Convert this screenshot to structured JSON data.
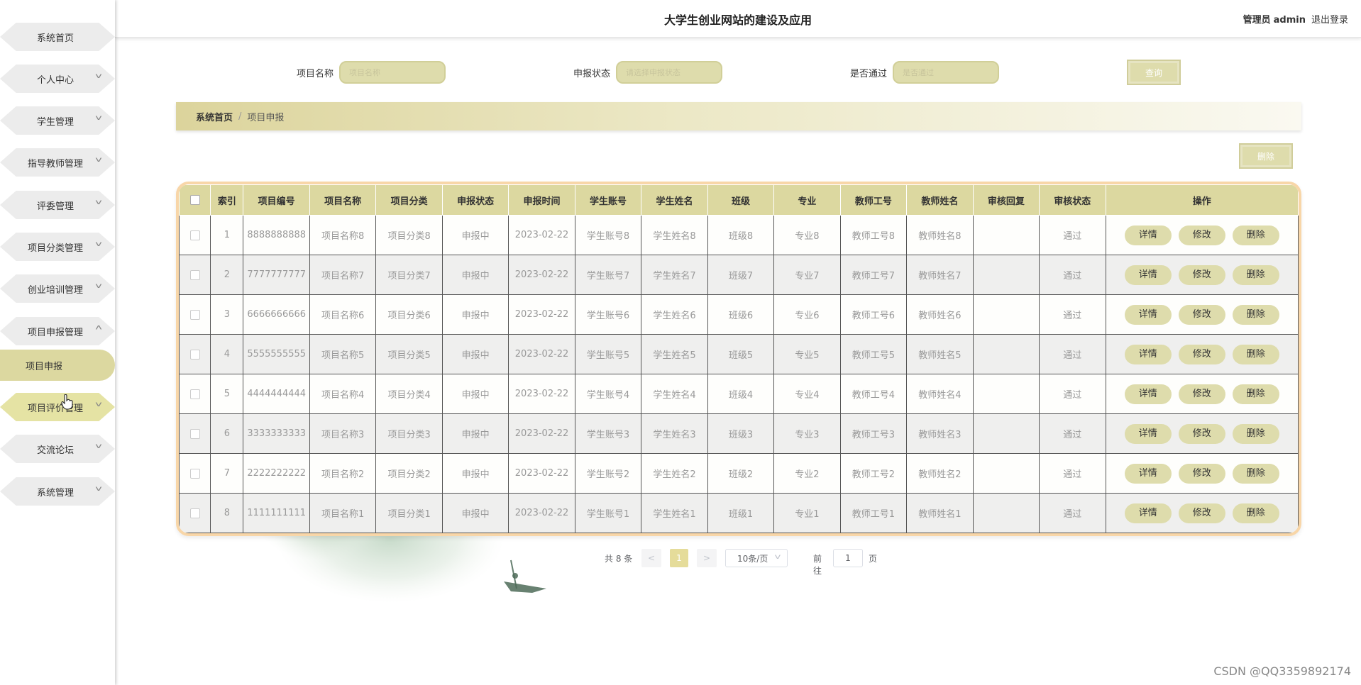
{
  "header": {
    "title": "大学生创业网站的建设及应用",
    "user_role": "管理员",
    "user_name": "admin",
    "logout_label": "退出登录"
  },
  "sidebar": {
    "items": [
      {
        "label": "系统首页",
        "has_chevron": false
      },
      {
        "label": "个人中心",
        "has_chevron": true
      },
      {
        "label": "学生管理",
        "has_chevron": true
      },
      {
        "label": "指导教师管理",
        "has_chevron": true
      },
      {
        "label": "评委管理",
        "has_chevron": true
      },
      {
        "label": "项目分类管理",
        "has_chevron": true
      },
      {
        "label": "创业培训管理",
        "has_chevron": true
      },
      {
        "label": "项目申报管理",
        "has_chevron": true,
        "expanded": true
      },
      {
        "label": "项目评价管理",
        "has_chevron": true
      },
      {
        "label": "交流论坛",
        "has_chevron": true
      },
      {
        "label": "系统管理",
        "has_chevron": true
      }
    ],
    "active_subitem": "项目申报"
  },
  "search": {
    "fields": [
      {
        "label": "项目名称",
        "placeholder": "项目名称"
      },
      {
        "label": "申报状态",
        "placeholder": "请选择申报状态"
      },
      {
        "label": "是否通过",
        "placeholder": "是否通过"
      }
    ],
    "query_button": "查询"
  },
  "breadcrumb": {
    "home": "系统首页",
    "separator": "/",
    "current": "项目申报"
  },
  "toolbar": {
    "delete_button": "删除"
  },
  "table": {
    "columns": [
      "索引",
      "项目编号",
      "项目名称",
      "项目分类",
      "申报状态",
      "申报时间",
      "学生账号",
      "学生姓名",
      "班级",
      "专业",
      "教师工号",
      "教师姓名",
      "审核回复",
      "审核状态",
      "操作"
    ],
    "rows": [
      [
        "1",
        "8888888888",
        "项目名称8",
        "项目分类8",
        "申报中",
        "2023-02-22",
        "学生账号8",
        "学生姓名8",
        "班级8",
        "专业8",
        "教师工号8",
        "教师姓名8",
        "",
        "通过"
      ],
      [
        "2",
        "7777777777",
        "项目名称7",
        "项目分类7",
        "申报中",
        "2023-02-22",
        "学生账号7",
        "学生姓名7",
        "班级7",
        "专业7",
        "教师工号7",
        "教师姓名7",
        "",
        "通过"
      ],
      [
        "3",
        "6666666666",
        "项目名称6",
        "项目分类6",
        "申报中",
        "2023-02-22",
        "学生账号6",
        "学生姓名6",
        "班级6",
        "专业6",
        "教师工号6",
        "教师姓名6",
        "",
        "通过"
      ],
      [
        "4",
        "5555555555",
        "项目名称5",
        "项目分类5",
        "申报中",
        "2023-02-22",
        "学生账号5",
        "学生姓名5",
        "班级5",
        "专业5",
        "教师工号5",
        "教师姓名5",
        "",
        "通过"
      ],
      [
        "5",
        "4444444444",
        "项目名称4",
        "项目分类4",
        "申报中",
        "2023-02-22",
        "学生账号4",
        "学生姓名4",
        "班级4",
        "专业4",
        "教师工号4",
        "教师姓名4",
        "",
        "通过"
      ],
      [
        "6",
        "3333333333",
        "项目名称3",
        "项目分类3",
        "申报中",
        "2023-02-22",
        "学生账号3",
        "学生姓名3",
        "班级3",
        "专业3",
        "教师工号3",
        "教师姓名3",
        "",
        "通过"
      ],
      [
        "7",
        "2222222222",
        "项目名称2",
        "项目分类2",
        "申报中",
        "2023-02-22",
        "学生账号2",
        "学生姓名2",
        "班级2",
        "专业2",
        "教师工号2",
        "教师姓名2",
        "",
        "通过"
      ],
      [
        "8",
        "1111111111",
        "项目名称1",
        "项目分类1",
        "申报中",
        "2023-02-22",
        "学生账号1",
        "学生姓名1",
        "班级1",
        "专业1",
        "教师工号1",
        "教师姓名1",
        "",
        "通过"
      ]
    ],
    "actions": [
      "详情",
      "修改",
      "删除"
    ]
  },
  "pagination": {
    "total_text": "共 8 条",
    "prev": "<",
    "current_page": "1",
    "next": ">",
    "page_size": "10条/页",
    "goto_label": "前往",
    "goto_value": "1",
    "page_suffix": "页"
  },
  "watermark": "CSDN @QQ3359892174",
  "colors": {
    "accent": "#dcd8a0",
    "accent_button": "#dedcac",
    "table_border": "#f8d6a8",
    "sidebar_hex": "#ececec",
    "sidebar_hex_hover": "#e5e3a4"
  },
  "icons": {
    "chevron_down": "chevron-down-icon",
    "chevron_up": "chevron-up-icon",
    "cursor": "hand-pointer-icon"
  }
}
